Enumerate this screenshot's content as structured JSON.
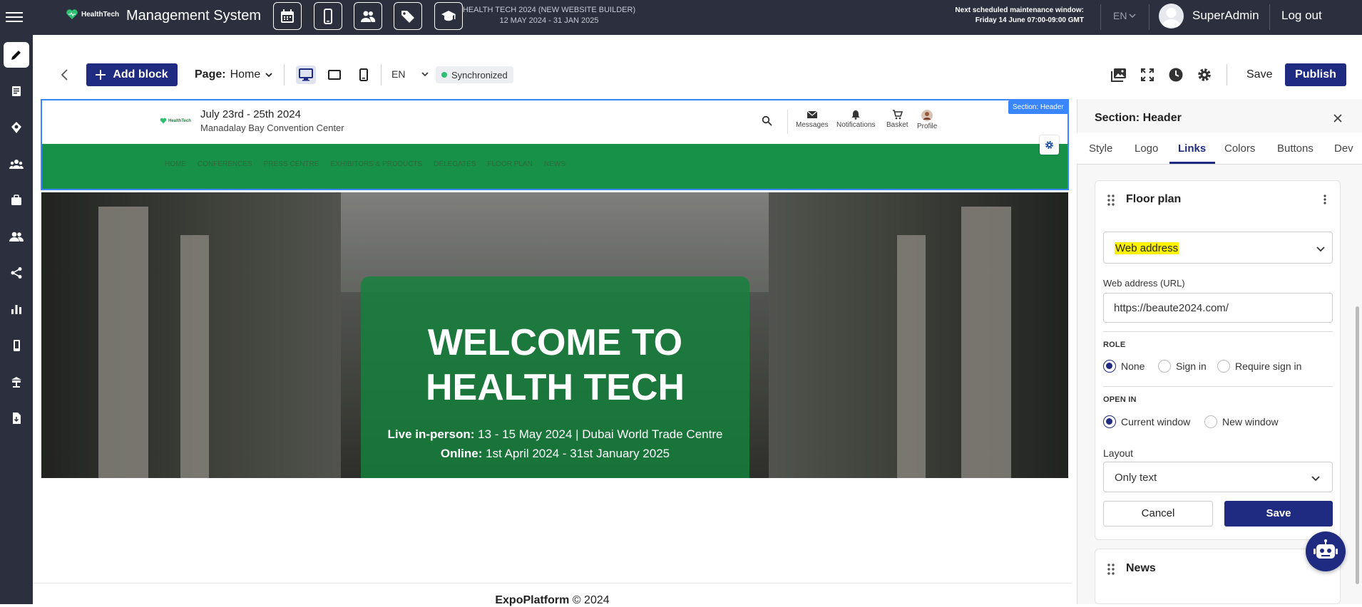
{
  "topbar": {
    "brand": "HealthTech",
    "app_title": "Management System",
    "event_name": "HEALTH TECH 2024 (NEW WEBSITE BUILDER)",
    "event_dates": "12 MAY 2024 - 31 JAN 2025",
    "maintenance_line1": "Next scheduled maintenance window:",
    "maintenance_line2": "Friday 14 June 07:00-09:00 GMT",
    "language": "EN",
    "user_name": "SuperAdmin",
    "logout": "Log out",
    "quick_icons": [
      "calendar-icon",
      "mobile-icon",
      "people-icon",
      "tag-icon",
      "graduation-cap-icon"
    ]
  },
  "rail": {
    "items": [
      "pencil-icon",
      "pages-icon",
      "badge-icon",
      "team-icon",
      "briefcase-icon",
      "users-icon",
      "share-icon",
      "chart-icon",
      "mobile-icon",
      "booth-icon",
      "export-file-icon"
    ]
  },
  "toolbar": {
    "add_block": "Add block",
    "page_label": "Page:",
    "page_value": "Home",
    "language": "EN",
    "sync_status": "Synchronized",
    "save": "Save",
    "publish": "Publish"
  },
  "preview": {
    "section_tag": "Section: Header",
    "logo_text": "HealthTech",
    "date": "July 23rd - 25th 2024",
    "venue": "Manadalay Bay Convention Center",
    "icons": [
      {
        "name": "messages",
        "label": "Messages"
      },
      {
        "name": "notifications",
        "label": "Notifications"
      },
      {
        "name": "basket",
        "label": "Basket"
      },
      {
        "name": "profile",
        "label": "Profile"
      }
    ],
    "nav_links": [
      "HOME",
      "CONFERENCES",
      "PRESS CENTRE",
      "EXHIBITORS & PRODUCTS",
      "DELEGATES",
      "FLOOR PLAN",
      "NEWS"
    ],
    "hero": {
      "title_line1": "WELCOME TO",
      "title_line2": "HEALTH TECH",
      "live_label": "Live in-person:",
      "live_value": " 13  - 15 May 2024 | Dubai World Trade Centre",
      "online_label": "Online:",
      "online_value": " 1st April 2024 - 31st January 2025"
    },
    "footer_brand": "ExpoPlatform",
    "footer_year": " © 2024"
  },
  "panel": {
    "title": "Section: Header",
    "tabs": [
      "Style",
      "Logo",
      "Links",
      "Colors",
      "Buttons",
      "Dev"
    ],
    "active_tab": "Links",
    "item_title": "Floor plan",
    "link_type": "Web address",
    "url_label": "Web address (URL)",
    "url_value": "https://beaute2024.com/",
    "role_heading": "ROLE",
    "role_options": [
      "None",
      "Sign in",
      "Require sign in"
    ],
    "role_selected": "None",
    "open_heading": "OPEN IN",
    "open_options": [
      "Current window",
      "New window"
    ],
    "open_selected": "Current window",
    "layout_label": "Layout",
    "layout_value": "Only text",
    "cancel": "Cancel",
    "save": "Save",
    "next_item_title": "News"
  },
  "colors": {
    "topbar": "#2b2f3e",
    "primary": "#1f2b80",
    "nav_green": "#169147",
    "selection_blue": "#3a86ff",
    "highlight_yellow": "#fff200"
  }
}
